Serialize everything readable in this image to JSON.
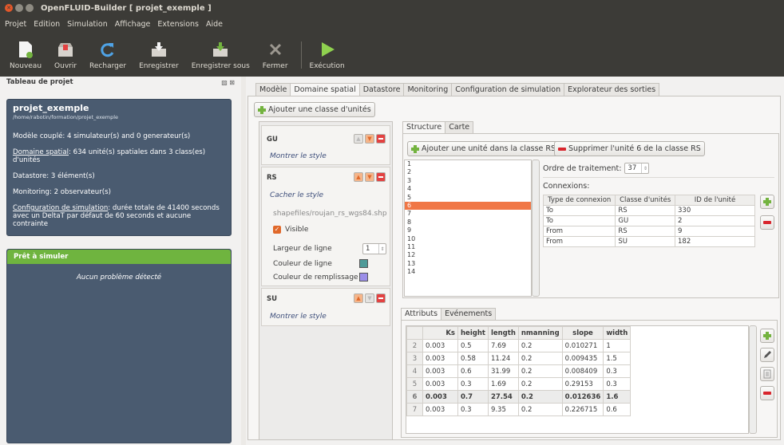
{
  "window": {
    "title": "OpenFLUID-Builder [ projet_exemple ]"
  },
  "menu": [
    "Projet",
    "Edition",
    "Simulation",
    "Affichage",
    "Extensions",
    "Aide"
  ],
  "toolbar": {
    "nouveau": "Nouveau",
    "ouvrir": "Ouvrir",
    "recharger": "Recharger",
    "enregistrer": "Enregistrer",
    "enregistrer_sous": "Enregistrer sous",
    "fermer": "Fermer",
    "execution": "Exécution"
  },
  "left": {
    "header": "Tableau de projet",
    "project_title": "projet_exemple",
    "project_path": "/home/rabotin/formation/projet_exemple",
    "model": "Modèle couplé: 4 simulateur(s) and 0 generateur(s)",
    "domain_link": "Domaine spatial",
    "domain_text": ": 634 unité(s) spatiales dans 3 class(es) d'unités",
    "datastore": "Datastore: 3 élément(s)",
    "monitoring": "Monitoring: 2 observateur(s)",
    "config_link": "Configuration de simulation",
    "config_text": ": durée totale de 41400 seconds avec un DeltaT par défaut de 60 seconds et aucune contrainte",
    "ready_title": "Prêt à simuler",
    "ready_msg": "Aucun problème détecté"
  },
  "tabs": [
    "Modèle",
    "Domaine spatial",
    "Datastore",
    "Monitoring",
    "Configuration de simulation",
    "Explorateur des sorties"
  ],
  "domain": {
    "add_class": "Ajouter une classe d'unités",
    "classes": {
      "gu": {
        "name": "GU",
        "style_link": "Montrer le style"
      },
      "rs": {
        "name": "RS",
        "style_link": "Cacher le style",
        "file": "shapefiles/roujan_rs_wgs84.shp",
        "visible": "Visible",
        "line_width_label": "Largeur de ligne",
        "line_width": "1",
        "line_color_label": "Couleur de ligne",
        "line_color": "#4e9a98",
        "fill_color_label": "Couleur de remplissage",
        "fill_color": "#9b8ee8"
      },
      "su": {
        "name": "SU",
        "style_link": "Montrer le style"
      }
    },
    "subtabs": [
      "Structure",
      "Carte"
    ],
    "add_unit": "Ajouter une unité dans la classe RS",
    "remove_unit": "Supprimer l'unité 6 de la classe RS",
    "units": [
      "1",
      "2",
      "3",
      "4",
      "5",
      "6",
      "7",
      "8",
      "9",
      "10",
      "11",
      "12",
      "13",
      "14"
    ],
    "selected_unit": "6",
    "order_label": "Ordre de traitement:",
    "order_value": "37",
    "connections_label": "Connexions:",
    "conn_headers": [
      "Type de connexion",
      "Classe d'unités",
      "ID de l'unité"
    ],
    "connections": [
      [
        "To",
        "RS",
        "330"
      ],
      [
        "To",
        "GU",
        "2"
      ],
      [
        "From",
        "RS",
        "9"
      ],
      [
        "From",
        "SU",
        "182"
      ]
    ],
    "attr_tabs": [
      "Attributs",
      "Evénements"
    ],
    "attr_headers": [
      "",
      "Ks",
      "height",
      "length",
      "nmanning",
      "slope",
      "width"
    ],
    "attr_rows": [
      [
        "2",
        "0.003",
        "0.5",
        "7.69",
        "0.2",
        "0.010271",
        "1"
      ],
      [
        "3",
        "0.003",
        "0.58",
        "11.24",
        "0.2",
        "0.009435",
        "1.5"
      ],
      [
        "4",
        "0.003",
        "0.6",
        "31.99",
        "0.2",
        "0.008409",
        "0.3"
      ],
      [
        "5",
        "0.003",
        "0.3",
        "1.69",
        "0.2",
        "0.29153",
        "0.3"
      ],
      [
        "6",
        "0.003",
        "0.7",
        "27.54",
        "0.2",
        "0.012636",
        "1.6"
      ],
      [
        "7",
        "0.003",
        "0.3",
        "9.35",
        "0.2",
        "0.226715",
        "0.6"
      ]
    ]
  }
}
